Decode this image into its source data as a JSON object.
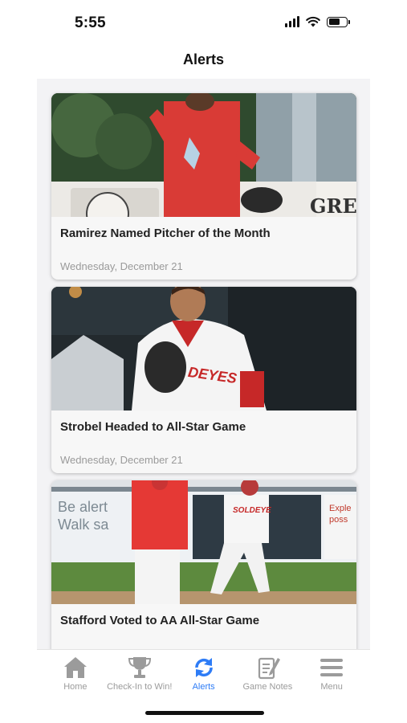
{
  "status_bar": {
    "time": "5:55"
  },
  "header": {
    "title": "Alerts"
  },
  "alerts": [
    {
      "title": "Ramirez Named Pitcher of the Month",
      "date": "Wednesday, December 21",
      "image_sign": "GRE"
    },
    {
      "title": "Strobel Headed to All-Star Game",
      "date": "Wednesday, December 21",
      "jersey": "DEYES"
    },
    {
      "title": "Stafford Voted to AA All-Star Game",
      "date": "",
      "sign_left": "Be alert\nWalk sa",
      "sign_right": "Exple\nposs",
      "jersey": "SOLDEYE"
    }
  ],
  "tabs": [
    {
      "label": "Home",
      "icon": "home-icon"
    },
    {
      "label": "Check-In to Win!",
      "icon": "trophy-icon"
    },
    {
      "label": "Alerts",
      "icon": "sync-alerts-icon",
      "active": true
    },
    {
      "label": "Game Notes",
      "icon": "notes-pencil-icon"
    },
    {
      "label": "Menu",
      "icon": "hamburger-menu-icon"
    }
  ],
  "colors": {
    "accent": "#2e7cf6",
    "tab_inactive": "#9b9b9b"
  }
}
